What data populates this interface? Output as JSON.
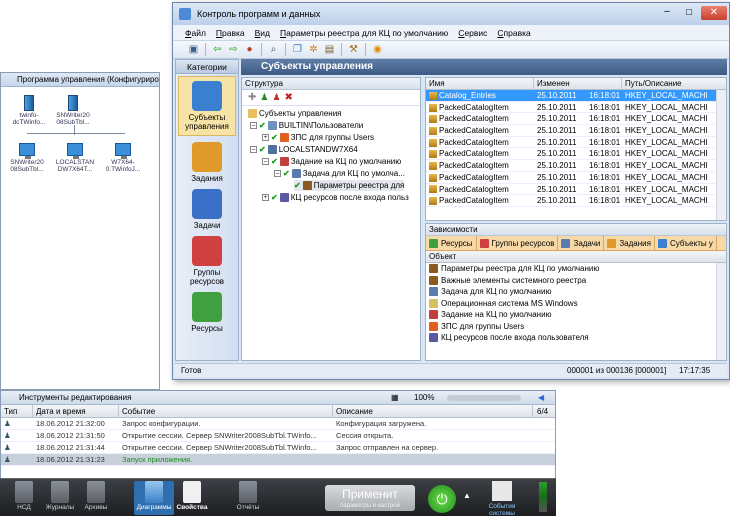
{
  "back_window": {
    "title": "Программа управления (Конфигурирование)",
    "nodes": [
      {
        "label1": "twinfo-",
        "label2": "dcTWinfo..."
      },
      {
        "label1": "SNWriter20",
        "label2": "08SubTbl..."
      },
      {
        "label1": "SNWriter20",
        "label2": "08SubTbl..."
      },
      {
        "label1": "LOCALSTAN",
        "label2": "DW7X64T..."
      },
      {
        "label1": "W7X64-",
        "label2": "0.TWinfoJ..."
      }
    ]
  },
  "main_window": {
    "title": "Контроль программ и данных",
    "menu": [
      "Файл",
      "Правка",
      "Вид",
      "Параметры реестра для КЦ по умолчанию",
      "Сервис",
      "Справка"
    ],
    "categories_header": "Категории",
    "categories": [
      {
        "label": "Субъекты управления",
        "color": "#3a7fd0"
      },
      {
        "label": "Задания",
        "color": "#e09a2a"
      },
      {
        "label": "Задачи",
        "color": "#3a6fc8"
      },
      {
        "label": "Группы ресурсов",
        "color": "#d04040"
      },
      {
        "label": "Ресурсы",
        "color": "#40a040"
      }
    ],
    "section_title": "Субъекты управления",
    "structure": {
      "header": "Структура",
      "nodes": [
        {
          "text": "Субъекты управления"
        },
        {
          "text": "BUILTIN\\Пользователи"
        },
        {
          "text": "ЗПС для группы Users"
        },
        {
          "text": "LOCALSTANDW7X64"
        },
        {
          "text": "Задание на КЦ по умолчанию"
        },
        {
          "text": "Задача для КЦ по умолча..."
        },
        {
          "text": "Параметры реестра для"
        },
        {
          "text": "КЦ ресурсов после входа польз"
        }
      ]
    },
    "grid": {
      "columns": [
        "Имя",
        "Изменен",
        "Путь/Описание"
      ],
      "rows": [
        {
          "name": "Catalog_Entries",
          "date": "25.10.2011",
          "time": "16:18:01",
          "path": "HKEY_LOCAL_MACHI"
        },
        {
          "name": "PackedCatalogItem",
          "date": "25.10.2011",
          "time": "16:18:01",
          "path": "HKEY_LOCAL_MACHI"
        },
        {
          "name": "PackedCatalogItem",
          "date": "25.10.2011",
          "time": "16:18:01",
          "path": "HKEY_LOCAL_MACHI"
        },
        {
          "name": "PackedCatalogItem",
          "date": "25.10.2011",
          "time": "16:18:01",
          "path": "HKEY_LOCAL_MACHI"
        },
        {
          "name": "PackedCatalogItem",
          "date": "25.10.2011",
          "time": "16:18:01",
          "path": "HKEY_LOCAL_MACHI"
        },
        {
          "name": "PackedCatalogItem",
          "date": "25.10.2011",
          "time": "16:18:01",
          "path": "HKEY_LOCAL_MACHI"
        },
        {
          "name": "PackedCatalogItem",
          "date": "25.10.2011",
          "time": "16:18:01",
          "path": "HKEY_LOCAL_MACHI"
        },
        {
          "name": "PackedCatalogItem",
          "date": "25.10.2011",
          "time": "16:18:01",
          "path": "HKEY_LOCAL_MACHI"
        },
        {
          "name": "PackedCatalogItem",
          "date": "25.10.2011",
          "time": "16:18:01",
          "path": "HKEY_LOCAL_MACHI"
        },
        {
          "name": "PackedCatalogItem",
          "date": "25.10.2011",
          "time": "16:18:01",
          "path": "HKEY_LOCAL_MACHI"
        }
      ]
    },
    "deps": {
      "header": "Зависимости",
      "tabs": [
        "Ресурсы",
        "Группы ресурсов",
        "Задачи",
        "Задания",
        "Субъекты у"
      ],
      "column": "Объект",
      "rows": [
        {
          "text": "Параметры реестра для КЦ по умолчанию",
          "color": "#8a5a20"
        },
        {
          "text": "Важные элементы системного реестра",
          "color": "#8a5a20"
        },
        {
          "text": "Задача для КЦ по умолчанию",
          "color": "#5a7ab0"
        },
        {
          "text": "Операционная система MS Windows",
          "color": "#d8c060"
        },
        {
          "text": "Задание на КЦ по умолчанию",
          "color": "#c04040"
        },
        {
          "text": "ЗПС для группы Users",
          "color": "#e06020"
        },
        {
          "text": "КЦ ресурсов после входа пользователя",
          "color": "#5a5aa0"
        }
      ]
    },
    "status": {
      "ready": "Готов",
      "counter": "000001 из 000136 [000001]",
      "time": "17:17:35"
    }
  },
  "log_panel": {
    "title": "Инструменты редактирования",
    "zoom": "100%",
    "page": "6/4",
    "columns": [
      "Тип",
      "Дата и время",
      "Событие",
      "Описание"
    ],
    "rows": [
      {
        "dt": "18.06.2012 21:32:00",
        "event": "Запрос конфигурации.",
        "desc": "Конфигурация загружена."
      },
      {
        "dt": "18.06.2012 21:31:50",
        "event": "Открытие сессии. Сервер SNWriter2008SubTbl.TWinfo...",
        "desc": "Сессия открыта."
      },
      {
        "dt": "18.06.2012 21:31:44",
        "event": "Открытие сессии. Сервер SNWriter2008SubTbl.TWinfo...",
        "desc": "Запрос отправлен на сервер."
      },
      {
        "dt": "18.06.2012 21:31:23",
        "event": "Запуск приложения.",
        "desc": ""
      }
    ]
  },
  "taskbar": {
    "items": [
      "НСД",
      "Журналы",
      "Архивы",
      "Диаграммы",
      "Свойства",
      "Отчёты"
    ],
    "apply_label": "Применит",
    "apply_sub": "параметры и настрой",
    "events_label": "События системы"
  }
}
